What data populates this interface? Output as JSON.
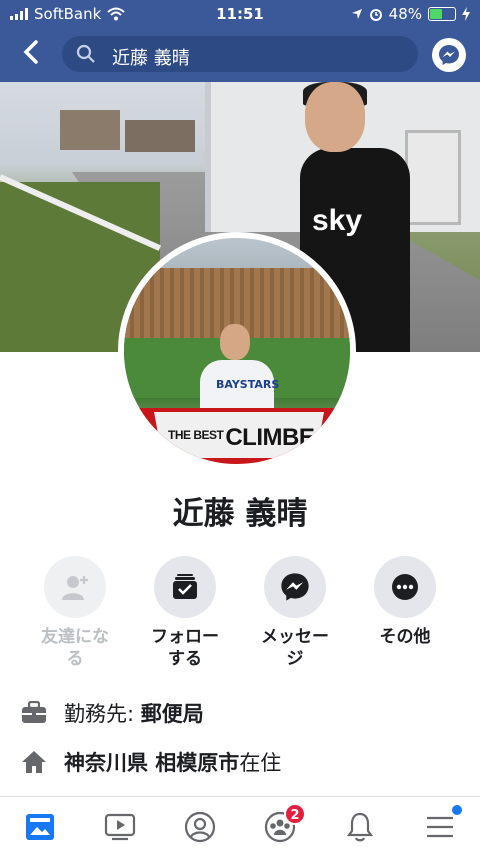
{
  "status_bar": {
    "carrier": "SoftBank",
    "time": "11:51",
    "battery": "48%"
  },
  "search": {
    "query": "近藤 義晴"
  },
  "profile": {
    "name": "近藤 義晴"
  },
  "avatar_banner": {
    "small": "THE BEST",
    "big": "CLIMBE"
  },
  "actions": [
    {
      "label": "友達にな\nる"
    },
    {
      "label": "フォロー\nする"
    },
    {
      "label": "メッセー\nジ"
    },
    {
      "label": "その他"
    }
  ],
  "work": {
    "prefix": "勤務先: ",
    "value": "郵便局"
  },
  "location": {
    "value": "神奈川県 相模原市",
    "suffix": "在住"
  },
  "tabbar": {
    "groups_badge": "2"
  },
  "colors": {
    "header": "#3b5998",
    "accent": "#1877f2",
    "badge": "#e41e3f",
    "battery": "#4cd964"
  }
}
